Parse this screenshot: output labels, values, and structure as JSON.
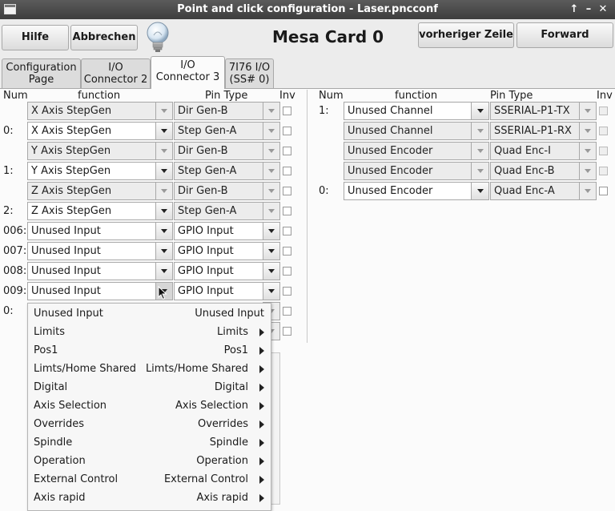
{
  "window": {
    "title": "Point and click configuration - Laser.pncconf",
    "controls": [
      "↑",
      "–",
      "✕"
    ]
  },
  "toolbar": {
    "help_label": "Hilfe",
    "cancel_label": "Abbrechen",
    "card_title": "Mesa Card 0",
    "prev_label": "vorheriger Zeile",
    "forward_label": "Forward"
  },
  "tabs": [
    {
      "line1": "Configuration",
      "line2": "Page"
    },
    {
      "line1": "I/O",
      "line2": "Connector 2"
    },
    {
      "line1": "I/O",
      "line2": "Connector 3"
    },
    {
      "line1": "7I76 I/O",
      "line2": "(SS# 0)"
    }
  ],
  "headers": {
    "num": "Num",
    "function": "function",
    "pin_type": "Pin Type",
    "inv": "Inv"
  },
  "left_rows": [
    {
      "num": "",
      "function": "X Axis StepGen",
      "pin_type": "Dir Gen-B"
    },
    {
      "num": "0:",
      "function": "X Axis StepGen",
      "pin_type": "Step Gen-A"
    },
    {
      "num": "",
      "function": "Y Axis StepGen",
      "pin_type": "Dir Gen-B"
    },
    {
      "num": "1:",
      "function": "Y Axis StepGen",
      "pin_type": "Step Gen-A"
    },
    {
      "num": "",
      "function": "Z Axis StepGen",
      "pin_type": "Dir Gen-B"
    },
    {
      "num": "2:",
      "function": "Z Axis StepGen",
      "pin_type": "Step Gen-A"
    },
    {
      "num": "006:",
      "function": "Unused Input",
      "pin_type": "GPIO Input"
    },
    {
      "num": "007:",
      "function": "Unused Input",
      "pin_type": "GPIO Input"
    },
    {
      "num": "008:",
      "function": "Unused Input",
      "pin_type": "GPIO Input"
    },
    {
      "num": "009:",
      "function": "Unused Input",
      "pin_type": "GPIO Input"
    },
    {
      "num": "0:",
      "function": "",
      "pin_type": ""
    }
  ],
  "right_rows": [
    {
      "num": "1:",
      "function": "Unused Channel",
      "pin_type": "SSERIAL-P1-TX"
    },
    {
      "num": "",
      "function": "Unused Channel",
      "pin_type": "SSERIAL-P1-RX"
    },
    {
      "num": "",
      "function": "Unused Encoder",
      "pin_type": "Quad Enc-I"
    },
    {
      "num": "",
      "function": "Unused Encoder",
      "pin_type": "Quad Enc-B"
    },
    {
      "num": "0:",
      "function": "Unused Encoder",
      "pin_type": "Quad Enc-A"
    }
  ],
  "menu_items": [
    {
      "left": "Unused Input",
      "right": "Unused Input",
      "submenu": false
    },
    {
      "left": "Limits",
      "right": "Limits",
      "submenu": true
    },
    {
      "left": "Pos1",
      "right": "Pos1",
      "submenu": true
    },
    {
      "left": "Limts/Home Shared",
      "right": "Limts/Home Shared",
      "submenu": true
    },
    {
      "left": "Digital",
      "right": "Digital",
      "submenu": true
    },
    {
      "left": "Axis Selection",
      "right": "Axis Selection",
      "submenu": true
    },
    {
      "left": "Overrides",
      "right": "Overrides",
      "submenu": true
    },
    {
      "left": "Spindle",
      "right": "Spindle",
      "submenu": true
    },
    {
      "left": "Operation",
      "right": "Operation",
      "submenu": true
    },
    {
      "left": "External Control",
      "right": "External Control",
      "submenu": true
    },
    {
      "left": "Axis rapid",
      "right": "Axis rapid",
      "submenu": true
    }
  ]
}
